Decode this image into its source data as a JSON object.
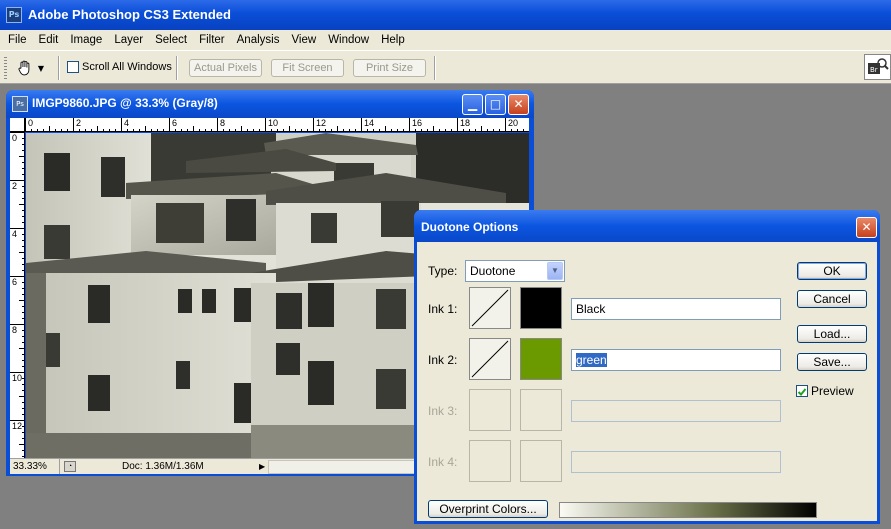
{
  "app": {
    "title": "Adobe Photoshop CS3 Extended",
    "icon_text": "Ps"
  },
  "menubar": {
    "items": [
      "File",
      "Edit",
      "Image",
      "Layer",
      "Select",
      "Filter",
      "Analysis",
      "View",
      "Window",
      "Help"
    ]
  },
  "options_bar": {
    "scroll_all_windows": "Scroll All Windows",
    "scroll_all_checked": false,
    "actual_pixels": "Actual Pixels",
    "fit_screen": "Fit Screen",
    "print_size": "Print Size"
  },
  "document": {
    "title": "IMGP9860.JPG @ 33.3% (Gray/8)",
    "zoom": "33.33%",
    "doc_info": "Doc: 1.36M/1.36M",
    "ruler_top_labels": [
      "0",
      "2",
      "4",
      "6",
      "8",
      "10",
      "12",
      "14",
      "16",
      "18",
      "20"
    ],
    "ruler_left_labels": [
      "0",
      "2",
      "4",
      "6",
      "8",
      "10",
      "12"
    ]
  },
  "dialog": {
    "title": "Duotone Options",
    "type_label": "Type:",
    "type_value": "Duotone",
    "inks": [
      {
        "label": "Ink 1:",
        "name": "Black",
        "color": "#000000",
        "enabled": true,
        "selected": false
      },
      {
        "label": "Ink 2:",
        "name": "green",
        "color": "#6b9a00",
        "enabled": true,
        "selected": true
      },
      {
        "label": "Ink 3:",
        "name": "",
        "color": "",
        "enabled": false,
        "selected": false
      },
      {
        "label": "Ink 4:",
        "name": "",
        "color": "",
        "enabled": false,
        "selected": false
      }
    ],
    "buttons": {
      "ok": "OK",
      "cancel": "Cancel",
      "load": "Load...",
      "save": "Save...",
      "overprint": "Overprint Colors..."
    },
    "preview_label": "Preview",
    "preview_checked": true
  },
  "colors": {
    "xp_blue": "#0a4ed8",
    "dialog_face": "#ece9d8",
    "workspace": "#808080"
  }
}
